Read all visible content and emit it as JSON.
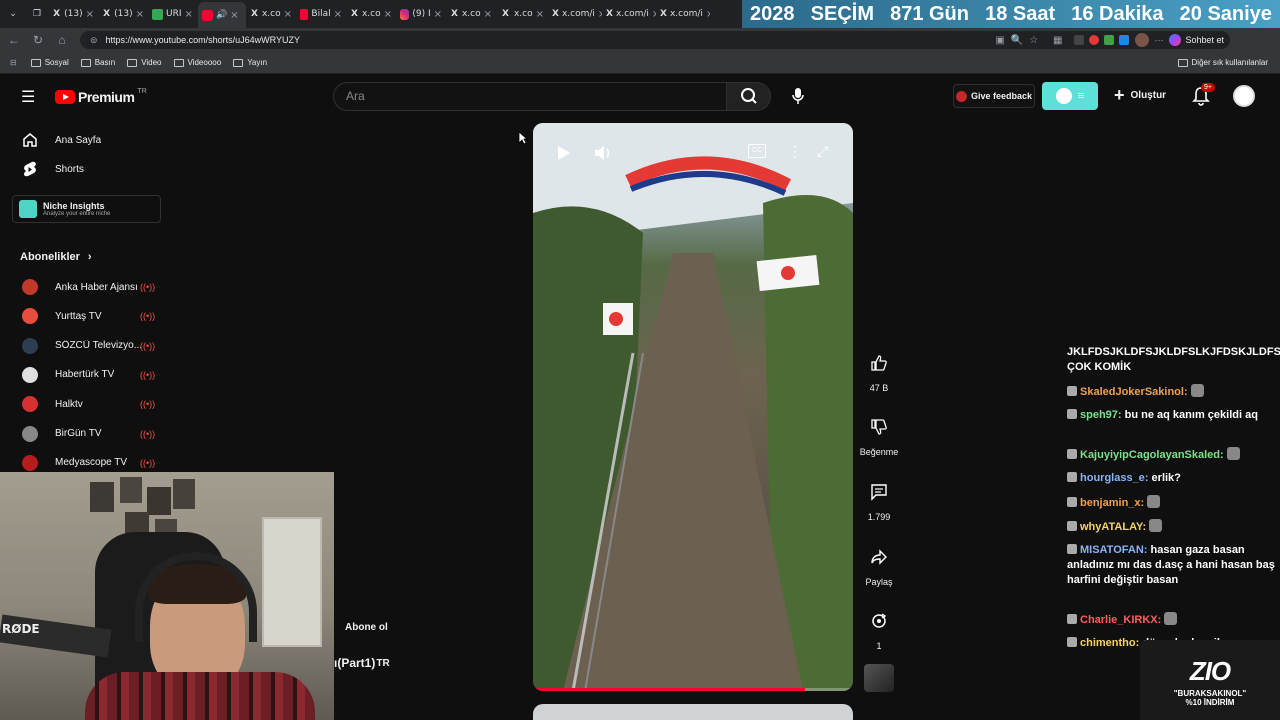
{
  "browser": {
    "tabs": [
      {
        "icon": "X",
        "label": "(13)"
      },
      {
        "icon": "X",
        "label": "(13)"
      },
      {
        "icon": "",
        "label": "URI"
      },
      {
        "icon": "",
        "label": ""
      },
      {
        "icon": "X",
        "label": "x.co"
      },
      {
        "icon": "",
        "label": "Bilal"
      },
      {
        "icon": "X",
        "label": "x.co"
      },
      {
        "icon": "",
        "label": "(9) I"
      },
      {
        "icon": "X",
        "label": "x.co"
      },
      {
        "icon": "X",
        "label": "x.co"
      },
      {
        "icon": "X",
        "label": "x.com/i"
      },
      {
        "icon": "X",
        "label": "x.com/i"
      },
      {
        "icon": "X",
        "label": "x.com/i"
      }
    ],
    "url": "https://www.youtube.com/shorts/uJ64wWRYUZY",
    "chat_button": "Sohbet et",
    "bookmarks": [
      "Sosyal",
      "Basın",
      "Video",
      "Videoooo",
      "Yayın"
    ],
    "other_bookmarks": "Diğer sık kullanılanlar"
  },
  "countdown": {
    "year": "2028",
    "label": "SEÇİM",
    "days": "871 Gün",
    "hours": "18 Saat",
    "minutes": "16 Dakika",
    "seconds": "20 Saniye"
  },
  "youtube": {
    "logo": "Premium",
    "logo_region": "TR",
    "search_placeholder": "Ara",
    "feedback": "Give feedback",
    "create": "Oluştur",
    "notifications": "9+",
    "sidebar": {
      "home": "Ana Sayfa",
      "shorts": "Shorts",
      "niche_title": "Niche Insights",
      "niche_sub": "Analyze your entire niche",
      "subscriptions_title": "Abonelikler",
      "channels": [
        {
          "name": "Anka Haber Ajansı",
          "color": "#c0392b"
        },
        {
          "name": "Yurttaş TV",
          "color": "#e74c3c"
        },
        {
          "name": "SÖZCÜ Televizyo...",
          "color": "#2c3e50"
        },
        {
          "name": "Habertürk TV",
          "color": "#e0e0e0"
        },
        {
          "name": "Halktv",
          "color": "#d63031"
        },
        {
          "name": "BirGün TV",
          "color": "#888888"
        },
        {
          "name": "Medyascope TV",
          "color": "#b71c1c"
        }
      ]
    },
    "short": {
      "subscribe": "Abone ol",
      "title_fragment": "ı(Part1)",
      "title_suffix": "TR",
      "progress": 0.85
    },
    "actions": {
      "likes": "47 B",
      "dislike": "Beğenme",
      "comments": "1.799",
      "share": "Paylaş",
      "remix": "1"
    }
  },
  "chat": [
    {
      "user": "",
      "message": "JKLFDSJKLDFSJKLDFSLKJFDSKJLDFS ÇOK KOMİK",
      "color": "#ffffff"
    },
    {
      "user": "SkaledJokerSakinol",
      "message": "",
      "color": "#f0a050"
    },
    {
      "user": "speh97",
      "message": "bu ne aq kanım çekildi aq",
      "color": "#7ee08a"
    },
    {
      "user": "KajuyiyipCagolayanSkaled",
      "message": "",
      "color": "#7ee08a"
    },
    {
      "user": "hourglass_e",
      "message": "erlik?",
      "color": "#8ab4f8"
    },
    {
      "user": "benjamin_x",
      "message": "",
      "color": "#f0a050"
    },
    {
      "user": "whyATALAY",
      "message": "",
      "color": "#f6d365"
    },
    {
      "user": "MISATOFAN",
      "message": "hasan gaza basan anladınız mı das d.asç a hani hasan baş harfini değiştir basan",
      "color": "#8ab4f8"
    },
    {
      "user": "Charlie_KIRKX",
      "message": "",
      "color": "#ff5c5c"
    },
    {
      "user": "chimentho",
      "message": "düşenler komik",
      "color": "#f6d365"
    }
  ],
  "promo": {
    "brand": "ZIO",
    "code": "\"BURAKSAKINOL\"",
    "discount": "%10 İNDİRİM"
  }
}
